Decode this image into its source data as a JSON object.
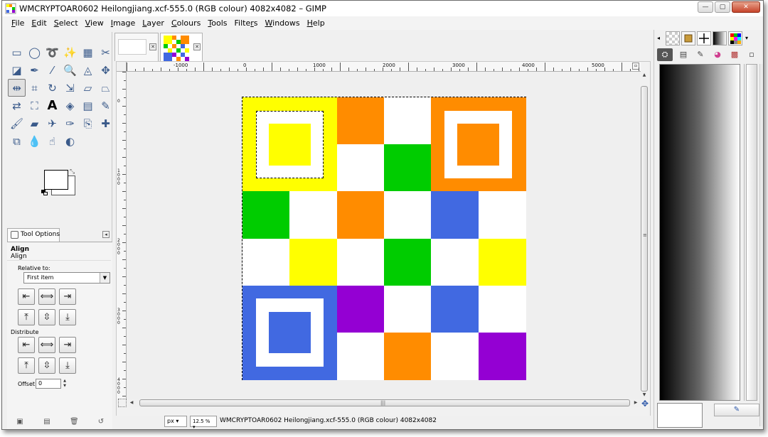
{
  "window": {
    "title": "WMCRYPTOAR0602 Heilongjiang.xcf-555.0 (RGB colour) 4082x4082 – GIMP",
    "controls": {
      "minimize": "—",
      "maximize": "▢",
      "close": "✕"
    }
  },
  "menubar": {
    "items": [
      {
        "label": "File",
        "key": "F"
      },
      {
        "label": "Edit",
        "key": "E"
      },
      {
        "label": "Select",
        "key": "S"
      },
      {
        "label": "View",
        "key": "V"
      },
      {
        "label": "Image",
        "key": "I"
      },
      {
        "label": "Layer",
        "key": "L"
      },
      {
        "label": "Colours",
        "key": "C"
      },
      {
        "label": "Tools",
        "key": "T"
      },
      {
        "label": "Filters",
        "key": "r"
      },
      {
        "label": "Windows",
        "key": "W"
      },
      {
        "label": "Help",
        "key": "H"
      }
    ]
  },
  "toolbox": {
    "tools": [
      {
        "name": "rect-select-icon",
        "glyph": "▭"
      },
      {
        "name": "ellipse-select-icon",
        "glyph": "◯"
      },
      {
        "name": "free-select-icon",
        "glyph": "➰"
      },
      {
        "name": "fuzzy-select-icon",
        "glyph": "✨"
      },
      {
        "name": "select-by-color-icon",
        "glyph": "▦"
      },
      {
        "name": "scissors-icon",
        "glyph": "✂"
      },
      {
        "name": "foreground-select-icon",
        "glyph": "◪"
      },
      {
        "name": "paths-icon",
        "glyph": "✒"
      },
      {
        "name": "color-picker-icon",
        "glyph": "⁄"
      },
      {
        "name": "zoom-icon",
        "glyph": "🔍"
      },
      {
        "name": "measure-icon",
        "glyph": "◬"
      },
      {
        "name": "move-icon",
        "glyph": "✥"
      },
      {
        "name": "align-icon",
        "glyph": "⇹"
      },
      {
        "name": "crop-icon",
        "glyph": "⌗"
      },
      {
        "name": "rotate-icon",
        "glyph": "↻"
      },
      {
        "name": "scale-icon",
        "glyph": "⇲"
      },
      {
        "name": "shear-icon",
        "glyph": "▱"
      },
      {
        "name": "perspective-icon",
        "glyph": "⏢"
      },
      {
        "name": "flip-icon",
        "glyph": "⇄"
      },
      {
        "name": "cage-icon",
        "glyph": "⛶"
      },
      {
        "name": "text-icon",
        "glyph": "A"
      },
      {
        "name": "bucket-fill-icon",
        "glyph": "◈"
      },
      {
        "name": "blend-icon",
        "glyph": "▤"
      },
      {
        "name": "pencil-icon",
        "glyph": "✎"
      },
      {
        "name": "paintbrush-icon",
        "glyph": "🖌"
      },
      {
        "name": "eraser-icon",
        "glyph": "▰"
      },
      {
        "name": "airbrush-icon",
        "glyph": "✈"
      },
      {
        "name": "ink-icon",
        "glyph": "✑"
      },
      {
        "name": "clone-icon",
        "glyph": "⎘"
      },
      {
        "name": "heal-icon",
        "glyph": "✚"
      },
      {
        "name": "perspective-clone-icon",
        "glyph": "⧉"
      },
      {
        "name": "blur-icon",
        "glyph": "💧"
      },
      {
        "name": "smudge-icon",
        "glyph": "☝"
      },
      {
        "name": "dodge-burn-icon",
        "glyph": "◐"
      }
    ],
    "active_tool": "align-icon"
  },
  "tool_options": {
    "tab_label": "Tool Options",
    "title": "Align",
    "subtitle": "Align",
    "relative_to_label": "Relative to:",
    "relative_to_value": "First item",
    "distribute_label": "Distribute",
    "offset_label": "Offset:",
    "offset_value": "0"
  },
  "image_tabs": [
    {
      "name": "blank-image",
      "active": false
    },
    {
      "name": "checker-image",
      "active": true
    }
  ],
  "ruler": {
    "h_labels": [
      {
        "text": "-1000",
        "pos": 64
      },
      {
        "text": "0",
        "pos": 162
      },
      {
        "text": "1000",
        "pos": 260
      },
      {
        "text": "2000",
        "pos": 358
      },
      {
        "text": "3000",
        "pos": 456
      },
      {
        "text": "4000",
        "pos": 554
      },
      {
        "text": "5000",
        "pos": 652
      }
    ],
    "v_labels": [
      {
        "text": "0",
        "pos": 37
      },
      {
        "text": "1000",
        "pos": 135
      },
      {
        "text": "2000",
        "pos": 233
      },
      {
        "text": "3000",
        "pos": 331
      },
      {
        "text": "4000",
        "pos": 429
      }
    ]
  },
  "canvas": {
    "colors": {
      "yellow": "#ffff00",
      "orange": "#ff8c00",
      "green": "#00cc00",
      "blue": "#4169e1",
      "purple": "#9400d3",
      "white": "#ffffff"
    },
    "grid": [
      [
        "yellow",
        "yellow",
        "orange",
        "white",
        "orange",
        "orange"
      ],
      [
        "yellow",
        "yellow",
        "white",
        "green",
        "orange",
        "orange"
      ],
      [
        "green",
        "white",
        "orange",
        "white",
        "blue",
        "white"
      ],
      [
        "white",
        "yellow",
        "white",
        "green",
        "white",
        "yellow"
      ],
      [
        "blue",
        "blue",
        "purple",
        "white",
        "blue",
        "white"
      ],
      [
        "blue",
        "blue",
        "white",
        "orange",
        "white",
        "purple"
      ]
    ]
  },
  "statusbar": {
    "unit": "px",
    "zoom": "12.5 %",
    "text": "WMCRYPTOAR0602 Heilongjiang.xcf-555.0 (RGB colour) 4082x4082"
  }
}
